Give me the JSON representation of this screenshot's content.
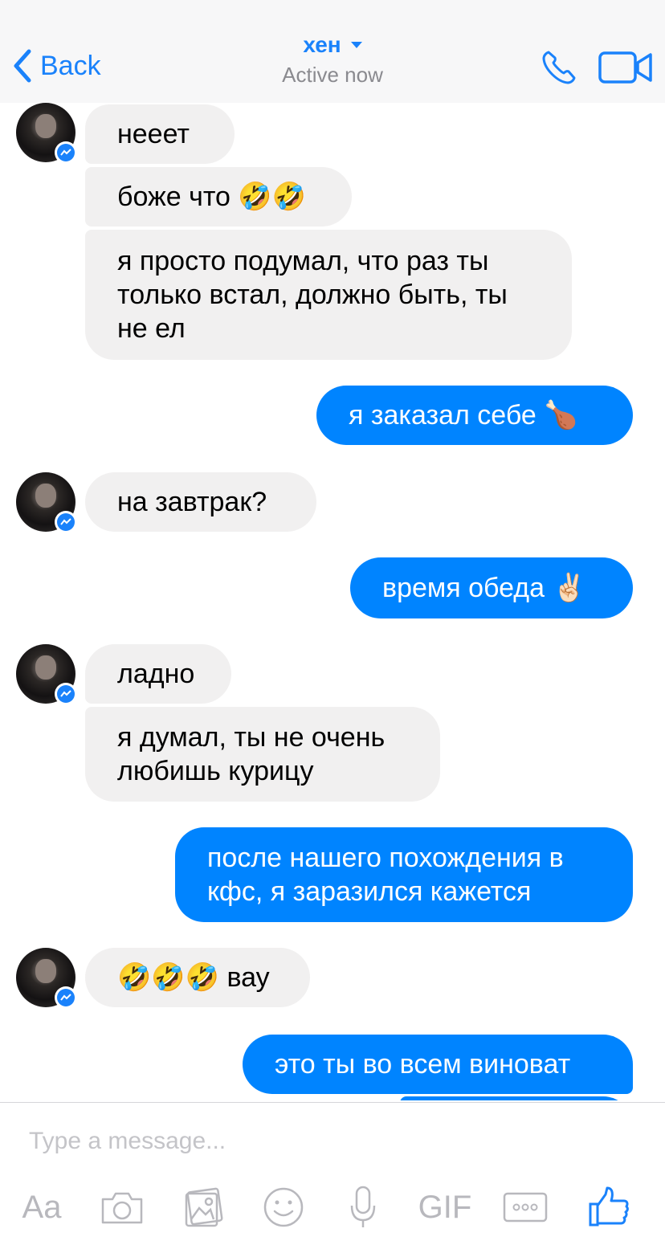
{
  "header": {
    "back_label": "Back",
    "contact_name": "хен",
    "status": "Active now"
  },
  "messages": [
    {
      "side": "in",
      "text": "нееет"
    },
    {
      "side": "in",
      "text": "боже что 🤣🤣"
    },
    {
      "side": "in",
      "text": "я просто подумал, что раз ты только встал, должно быть, ты не ел"
    },
    {
      "side": "out",
      "text": "я заказал себе 🍗"
    },
    {
      "side": "in",
      "text": "на завтрак?"
    },
    {
      "side": "out",
      "text": "время обеда ✌🏻"
    },
    {
      "side": "in",
      "text": "ладно"
    },
    {
      "side": "in",
      "text": "я думал, ты не очень любишь курицу"
    },
    {
      "side": "out",
      "text": "после нашего похождения в кфс, я заразился кажется"
    },
    {
      "side": "in",
      "text": "🤣🤣🤣 вау"
    },
    {
      "side": "out",
      "text": "это ты во всем виноват"
    }
  ],
  "composer": {
    "placeholder": "Type a message...",
    "text_tool": "Aa",
    "gif_tool": "GIF"
  },
  "colors": {
    "accent": "#0084ff",
    "link": "#1a82fb",
    "incoming_bubble": "#f1f0f0",
    "header_bg": "#f7f7f8"
  },
  "icons": [
    "back-chevron-icon",
    "phone-icon",
    "video-camera-icon",
    "messenger-badge-icon",
    "camera-icon",
    "photo-gallery-icon",
    "emoji-icon",
    "microphone-icon",
    "more-icon",
    "thumbs-up-icon"
  ]
}
